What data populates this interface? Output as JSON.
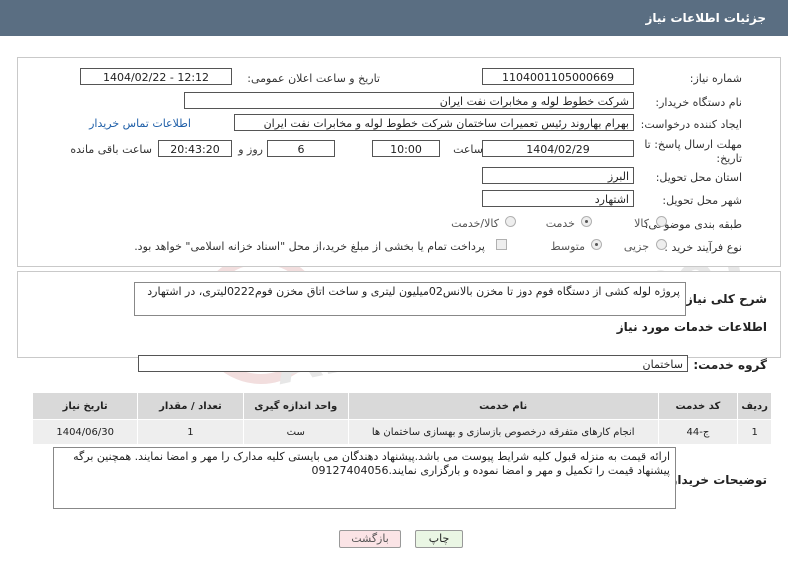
{
  "header": {
    "title": "جزئیات اطلاعات نیاز"
  },
  "watermark": {
    "text": "AriaTender.neT"
  },
  "form": {
    "need_number_label": "شماره نیاز:",
    "need_number": "1104001105000669",
    "announce_label": "تاریخ و ساعت اعلان عمومی:",
    "announce_value": "1404/02/22 - 12:12",
    "buyer_label": "نام دستگاه خریدار:",
    "buyer_value": "شرکت خطوط لوله و مخابرات نفت ایران",
    "creator_label": "ایجاد کننده درخواست:",
    "creator_value": "بهرام بهاروند رئیس تعمیرات ساختمان شرکت خطوط لوله و مخابرات نفت ایران",
    "contact_link": "اطلاعات تماس خریدار",
    "deadline_label": "مهلت ارسال پاسخ: تا تاریخ:",
    "deadline_date": "1404/02/29",
    "time_label": "ساعت",
    "deadline_time": "10:00",
    "days_value": "6",
    "days_label": "روز و",
    "remaining_time": "20:43:20",
    "remaining_label": "ساعت باقی مانده",
    "province_label": "استان محل تحویل:",
    "province_value": "البرز",
    "city_label": "شهر محل تحویل:",
    "city_value": "اشتهارد",
    "category_label": "طبقه بندی موضوعی:",
    "category_options": [
      "کالا",
      "خدمت",
      "کالا/خدمت"
    ],
    "category_selected": "خدمت",
    "process_label": "نوع فرآیند خرید :",
    "process_options": [
      "جزیی",
      "متوسط"
    ],
    "process_selected": "متوسط",
    "payment_note": "پرداخت تمام یا بخشی از مبلغ خرید،از محل \"اسناد خزانه اسلامی\" خواهد بود."
  },
  "summary": {
    "label": "شرح کلی نیاز:",
    "text": "پروژه لوله کشی از دستگاه فوم دوز تا مخزن بالانس02میلیون لیتری و ساخت اتاق مخزن فوم0222لیتری، در اشتهارد"
  },
  "services": {
    "section_title": "اطلاعات خدمات مورد نیاز",
    "group_label": "گروه خدمت:",
    "group_value": "ساختمان",
    "columns": [
      "ردیف",
      "کد خدمت",
      "نام خدمت",
      "واحد اندازه گیری",
      "تعداد / مقدار",
      "تاریخ نیاز"
    ],
    "rows": [
      [
        "1",
        "ج-44",
        "انجام کارهای متفرقه درخصوص بازسازی و بهسازی ساختمان ها",
        "ست",
        "1",
        "1404/06/30"
      ]
    ]
  },
  "buyer_notes": {
    "label": "توضیحات خریدار:",
    "text": "ارائه قیمت به منزله قبول کلیه شرایط پیوست می باشد.پیشنهاد دهندگان می بایستی کلیه مدارک را مهر و امضا نمایند. همچنین برگه پیشنهاد قیمت را تکمیل و مهر و امضا نموده و بارگزاری نمایند.09127404056"
  },
  "buttons": {
    "print": "چاپ",
    "back": "بازگشت"
  },
  "colors": {
    "titlebar": "#5a6e82",
    "back_button_bg": "#fbe4e6",
    "print_button_bg": "#eaf6e4",
    "link": "#1f5fa8"
  }
}
